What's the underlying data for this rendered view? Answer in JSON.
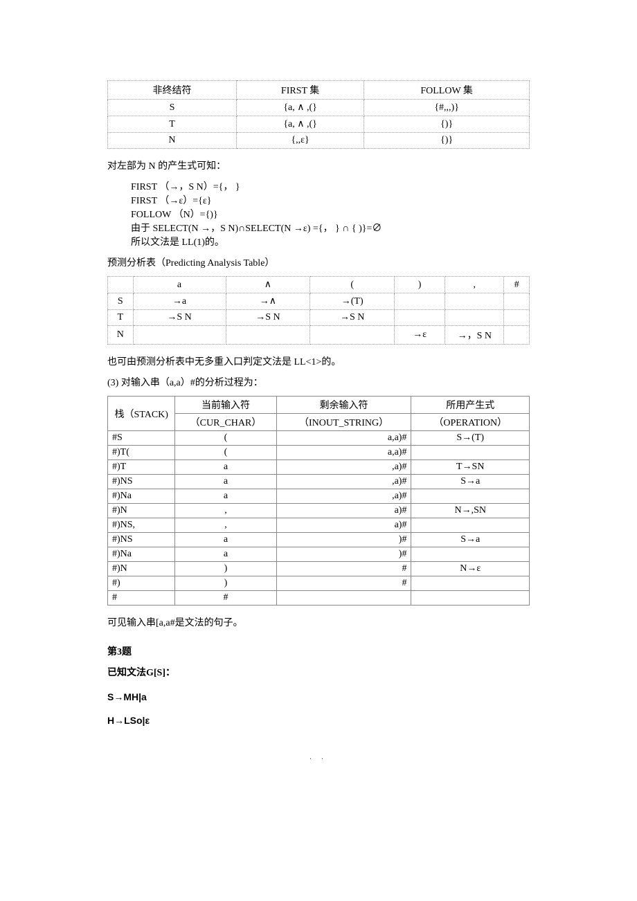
{
  "table1": {
    "h1": "非终结符",
    "h2": "FIRST 集",
    "h3": "FOLLOW 集",
    "r1c1": "S",
    "r1c2": "{a, ∧ ,(}",
    "r1c3": "{#,,,)}",
    "r2c1": "T",
    "r2c2": "{a, ∧ ,(}",
    "r2c3": "{)}",
    "r3c1": "N",
    "r3c2": "{,,ε}",
    "r3c3": "{)}"
  },
  "para1": "对左部为 N 的产生式可知：",
  "line1": "FIRST  （→，S N）={， }",
  "line2": "FIRST  （→ε）={ε}",
  "line3": "FOLLOW  （N）={)}",
  "line4": "由于 SELECT(N →，S N)∩SELECT(N →ε) ={， } ∩ { )}=∅",
  "line5": "所以文法是 LL(1)的。",
  "para2": "预测分析表（Predicting Analysis Table）",
  "table2": {
    "h": [
      "",
      "a",
      "∧",
      "(",
      ")",
      ",",
      "#"
    ],
    "r1": [
      "S",
      "→a",
      "→∧",
      "→(T)",
      "",
      "",
      ""
    ],
    "r2": [
      "T",
      "→S N",
      "→S N",
      "→S N",
      "",
      "",
      ""
    ],
    "r3": [
      "N",
      "",
      "",
      "",
      "→ε",
      "→，S N",
      ""
    ]
  },
  "para3": "也可由预测分析表中无多重入口判定文法是 LL<1>的。",
  "para4": "(3) 对输入串（a,a）#的分析过程为：",
  "table3": {
    "h1a": "栈（STACK)",
    "h2a": "当前输入符",
    "h2b": "（CUR_CHAR）",
    "h3a": "剩余输入符",
    "h3b": "（INOUT_STRING）",
    "h4a": "所用产生式",
    "h4b": "（OPERATION）",
    "rows": [
      [
        "#S",
        "(",
        "a,a)#",
        "S→(T)"
      ],
      [
        "#)T(",
        "(",
        "a,a)#",
        ""
      ],
      [
        "#)T",
        "a",
        ",a)#",
        "T→SN"
      ],
      [
        "#)NS",
        "a",
        ",a)#",
        "S→a"
      ],
      [
        "#)Na",
        "a",
        ",a)#",
        ""
      ],
      [
        "#)N",
        ",",
        "a)#",
        "N→,SN"
      ],
      [
        "#)NS,",
        ",",
        "a)#",
        ""
      ],
      [
        "#)NS",
        "a",
        ")#",
        "S→a"
      ],
      [
        "#)Na",
        "a",
        ")#",
        ""
      ],
      [
        "#)N",
        ")",
        "#",
        "N→ε"
      ],
      [
        "#)",
        ")",
        "#",
        ""
      ],
      [
        "#",
        "#",
        "",
        ""
      ]
    ]
  },
  "para5": "可见输入串[a,a#是文法的句子。",
  "q3": "第3题",
  "q3line1": "已知文法G[S]：",
  "g1": "S→MH|a",
  "g2": "H→LSo|ε",
  "footer": ".     ."
}
